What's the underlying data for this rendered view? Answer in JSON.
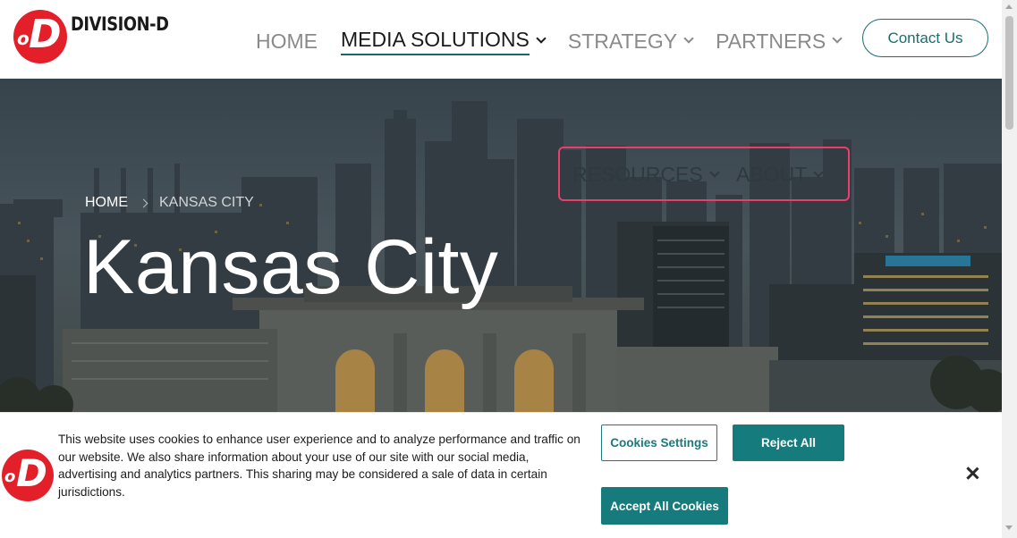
{
  "header": {
    "logo_text": "DIVISION-D",
    "nav": [
      {
        "label": "HOME",
        "has_dropdown": false,
        "active": false
      },
      {
        "label": "MEDIA SOLUTIONS",
        "has_dropdown": true,
        "active": true
      },
      {
        "label": "STRATEGY",
        "has_dropdown": true,
        "active": false
      },
      {
        "label": "PARTNERS",
        "has_dropdown": true,
        "active": false
      }
    ],
    "subnav": [
      {
        "label": "RESOURCES",
        "has_dropdown": true
      },
      {
        "label": "ABOUT",
        "has_dropdown": true
      }
    ],
    "contact_label": "Contact Us"
  },
  "hero": {
    "breadcrumb_home": "HOME",
    "breadcrumb_current": "KANSAS CITY",
    "title": "Kansas City"
  },
  "cookie": {
    "text": "This website uses cookies to enhance user experience and to analyze performance and traffic on our website. We also share information about your use of our site with our social media, advertising and analytics partners. This sharing may be considered a sale of data in certain jurisdictions.",
    "settings_label": "Cookies Settings",
    "reject_label": "Reject All",
    "accept_label": "Accept All Cookies"
  },
  "colors": {
    "brand_red": "#e3202a",
    "accent_teal": "#167b7d",
    "highlight_pink": "#ec3e6c"
  },
  "icons": [
    "chevron-down-icon",
    "chevron-right-icon",
    "close-icon"
  ]
}
